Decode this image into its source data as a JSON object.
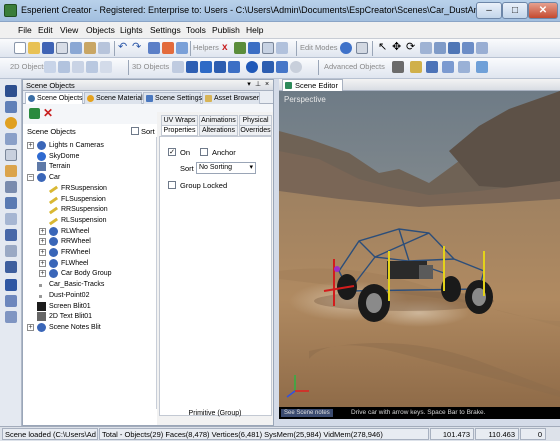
{
  "window": {
    "title": "Esperient Creator - Registered: Enterprise to: Users - C:\\Users\\Admin\\Documents\\EspCreator\\Scenes\\Car_DustAndTracks.rsn",
    "min_label": "–",
    "max_label": "□",
    "close_label": "✕"
  },
  "menu": [
    "File",
    "Edit",
    "View",
    "Objects",
    "Lights",
    "Settings",
    "Tools",
    "Publish",
    "Help"
  ],
  "toolbar": {
    "helpers_label": "Helpers",
    "edit_modes_label": "Edit Modes",
    "objects_2d_label": "2D Objects",
    "objects_3d_label": "3D Objects",
    "advanced_objects_label": "Advanced Objects"
  },
  "scene_objects": {
    "panel_title": "Scene Objects",
    "tabs": [
      "Scene Objects",
      "Scene Materials",
      "Scene Settings",
      "Asset Browser"
    ],
    "tree_header": "Scene Objects",
    "sort_label": "Sort",
    "tree": [
      {
        "label": "Lights n Cameras",
        "depth": 0,
        "expander": "+",
        "icon": "lights-icon"
      },
      {
        "label": "SkyDome",
        "depth": 0,
        "expander": "",
        "icon": "sphere-icon"
      },
      {
        "label": "Terrain",
        "depth": 0,
        "expander": "",
        "icon": "terrain-icon"
      },
      {
        "label": "Car",
        "depth": 0,
        "expander": "−",
        "icon": "group-icon"
      },
      {
        "label": "FRSuspension",
        "depth": 1,
        "expander": "",
        "icon": "bone-icon"
      },
      {
        "label": "FLSuspension",
        "depth": 1,
        "expander": "",
        "icon": "bone-icon"
      },
      {
        "label": "RRSuspension",
        "depth": 1,
        "expander": "",
        "icon": "bone-icon"
      },
      {
        "label": "RLSuspension",
        "depth": 1,
        "expander": "",
        "icon": "bone-icon"
      },
      {
        "label": "RLWheel",
        "depth": 1,
        "expander": "+",
        "icon": "group-icon"
      },
      {
        "label": "RRWheel",
        "depth": 1,
        "expander": "+",
        "icon": "group-icon"
      },
      {
        "label": "FRWheel",
        "depth": 1,
        "expander": "+",
        "icon": "group-icon"
      },
      {
        "label": "FLWheel",
        "depth": 1,
        "expander": "+",
        "icon": "group-icon"
      },
      {
        "label": "Car Body Group",
        "depth": 1,
        "expander": "+",
        "icon": "group-icon"
      },
      {
        "label": "Car_Basic-Tracks",
        "depth": 0,
        "expander": "",
        "icon": "dot-icon"
      },
      {
        "label": "Dust-Point02",
        "depth": 0,
        "expander": "",
        "icon": "dot-icon"
      },
      {
        "label": "Screen Blit01",
        "depth": 0,
        "expander": "",
        "icon": "screen-blit-icon"
      },
      {
        "label": "2D Text Blit01",
        "depth": 0,
        "expander": "",
        "icon": "text-blit-icon"
      },
      {
        "label": "Scene Notes Blit",
        "depth": 0,
        "expander": "+",
        "icon": "group-icon"
      }
    ],
    "prop_tabs_row1": [
      "UV Wraps",
      "Animations",
      "Physical"
    ],
    "prop_tabs_row2": [
      "Properties",
      "Alterations",
      "Overrides"
    ],
    "on_label": "On",
    "anchor_label": "Anchor",
    "sort_field_label": "Sort",
    "sort_value": "No Sorting",
    "group_locked_label": "Group Locked",
    "footer_label": "Primitive (Group)"
  },
  "scene_editor": {
    "tab_label": "Scene Editor",
    "view_label": "Perspective",
    "info_left": "See Scene notes",
    "info_right": "Drive car with arrow keys. Space Bar to Brake."
  },
  "status": {
    "message": "Scene loaded (C:\\Users\\Ad",
    "stats": "Total - Objects(29) Faces(8,478) Vertices(6,481) SysMem(25,984) VidMem(278,946)",
    "coord_x": "101.473",
    "coord_y": "110.463",
    "value": "0"
  },
  "colors": {
    "accent": "#3a6ea5",
    "sky": "#7f8f9a",
    "sand": "#b48a5c"
  }
}
